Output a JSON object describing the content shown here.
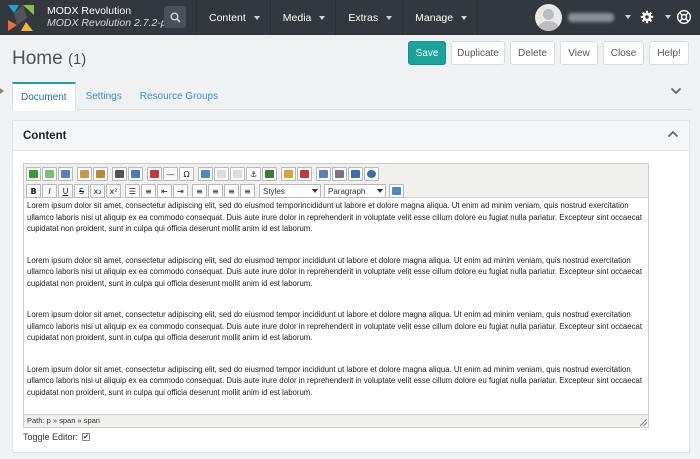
{
  "app": {
    "name": "MODX Revolution",
    "version": "MODX Revolution 2.7.2-pl"
  },
  "topnav": {
    "items": [
      "Content",
      "Media",
      "Extras",
      "Manage"
    ]
  },
  "page": {
    "title": "Home",
    "count": "(1)"
  },
  "actions": {
    "save": "Save",
    "duplicate": "Duplicate",
    "delete": "Delete",
    "view": "View",
    "close": "Close",
    "help": "Help!"
  },
  "tabs": [
    "Document",
    "Settings",
    "Resource Groups"
  ],
  "panel": {
    "title": "Content"
  },
  "editor": {
    "styles_select": "Styles",
    "format_select": "Paragraph",
    "paragraphs": [
      "Lorem ipsum dolor sit amet, consectetur adipiscing elit, sed do eiusmod temporincididunt ut labore et dolore magna aliqua. Ut enim ad minim veniam, quis nostrud exercitation ullamco laboris nisi ut aliquip ex ea commodo consequat. Duis aute irure dolor in reprehenderit in voluptate velit esse cillum dolore eu fugiat nulla pariatur. Excepteur sint occaecat cupidatat non proident, sunt in culpa qui officia deserunt mollit anim id est laborum.",
      "Lorem ipsum dolor sit amet, consectetur adipiscing elit, sed do eiusmod tempor incididunt ut labore et dolore magna aliqua. Ut enim ad minim veniam, quis nostrud exercitation ullamco laboris nisi ut aliquip ex ea commodo consequat. Duis aute irure dolor in reprehenderit in voluptate velit esse cillum dolore eu fugiat nulla pariatur. Excepteur sint occaecat cupidatat non proident, sunt in culpa qui officia deserunt mollit anim id est laborum.",
      "Lorem ipsum dolor sit amet, consectetur adipiscing elit, sed do eiusmod tempor incididunt ut labore et dolore magna aliqua. Ut enim ad minim veniam, quis nostrud exercitation ullamco laboris nisi ut aliquip ex ea commodo consequat. Duis aute irure dolor in reprehenderit in voluptate velit esse cillum dolore eu fugiat nulla pariatur. Excepteur sint occaecat cupidatat non proident, sunt in culpa qui officia deserunt mollit anim id est laborum.",
      "Lorem ipsum dolor sit amet, consectetur adipiscing elit, sed do eiusmod tempor incididunt ut labore et dolore magna aliqua. Ut enim ad minim veniam, quis nostrud exercitation ullamco laboris nisi ut aliquip ex ea commodo consequat. Duis aute irure dolor in reprehenderit in voluptate velit esse cillum dolore eu fugiat nulla pariatur. Excepteur sint occaecat cupidatat non proident, sunt in culpa qui officia deserunt mollit anim id est laborum."
    ],
    "path": "Path: p » span » span"
  },
  "toggle_editor": {
    "label": "Toggle Editor:",
    "checked": "✔"
  },
  "colors": {
    "topbar": "#33383e",
    "accent": "#1aa39a",
    "link": "#3a8fd0"
  }
}
